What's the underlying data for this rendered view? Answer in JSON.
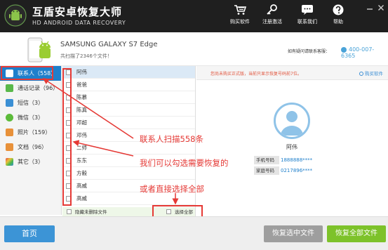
{
  "header": {
    "title": "互盾安卓恢复大师",
    "subtitle": "HD ANDROID DATA RECOVERY",
    "buttons": [
      {
        "label": "购买软件",
        "icon": "cart-icon"
      },
      {
        "label": "注册激活",
        "icon": "key-icon"
      },
      {
        "label": "联系我们",
        "icon": "chat-icon"
      },
      {
        "label": "帮助",
        "icon": "help-icon"
      }
    ]
  },
  "device": {
    "name": "SAMSUNG  GALAXY S7 Edge",
    "count_text": "共扫描了2346个文件！",
    "help_text": "如有疑问请联系客服：",
    "help_phone": "400-007-6365"
  },
  "sidebar": {
    "items": [
      {
        "label": "联系人（558）",
        "icon": "contacts-icon",
        "color": "#3b8fd4"
      },
      {
        "label": "通话记录（96）",
        "icon": "phone-icon",
        "color": "#59b84a"
      },
      {
        "label": "短信（3）",
        "icon": "sms-icon",
        "color": "#3b8fd4"
      },
      {
        "label": "微信（3）",
        "icon": "wechat-icon",
        "color": "#5cbb3a"
      },
      {
        "label": "照片（159）",
        "icon": "photo-icon",
        "color": "#e8913a"
      },
      {
        "label": "文档（96）",
        "icon": "document-icon",
        "color": "#e8913a"
      },
      {
        "label": "其它（3）",
        "icon": "other-icon",
        "color": "#d64a8a"
      }
    ]
  },
  "list": {
    "rows": [
      "阿伟",
      "爸爸",
      "陈慕",
      "陈真",
      "邓超",
      "邓伟",
      "二师",
      "东东",
      "方毅",
      "高威",
      "高威"
    ],
    "footer_hide": "隐藏未删除文件",
    "footer_select_all": "选择全部"
  },
  "details": {
    "notice": "您尚未购买正式版，当前只显示恢复号码前7位。",
    "buy_link": "购买软件",
    "name": "阿伟",
    "fields": [
      {
        "key": "手机号码",
        "value": "1888888****"
      },
      {
        "key": "家庭号码",
        "value": "0217896****"
      }
    ]
  },
  "annotations": {
    "a1": "联系人扫描558条",
    "a2": "我们可以勾选需要恢复的",
    "a3": "或者直接选择全部"
  },
  "bottom": {
    "home": "首页",
    "recover_selected": "恢复选中文件",
    "recover_all": "恢复全部文件"
  },
  "colors": {
    "accent": "#1e7fcb",
    "annotation": "#e53935",
    "recover_all": "#7dc22a"
  }
}
